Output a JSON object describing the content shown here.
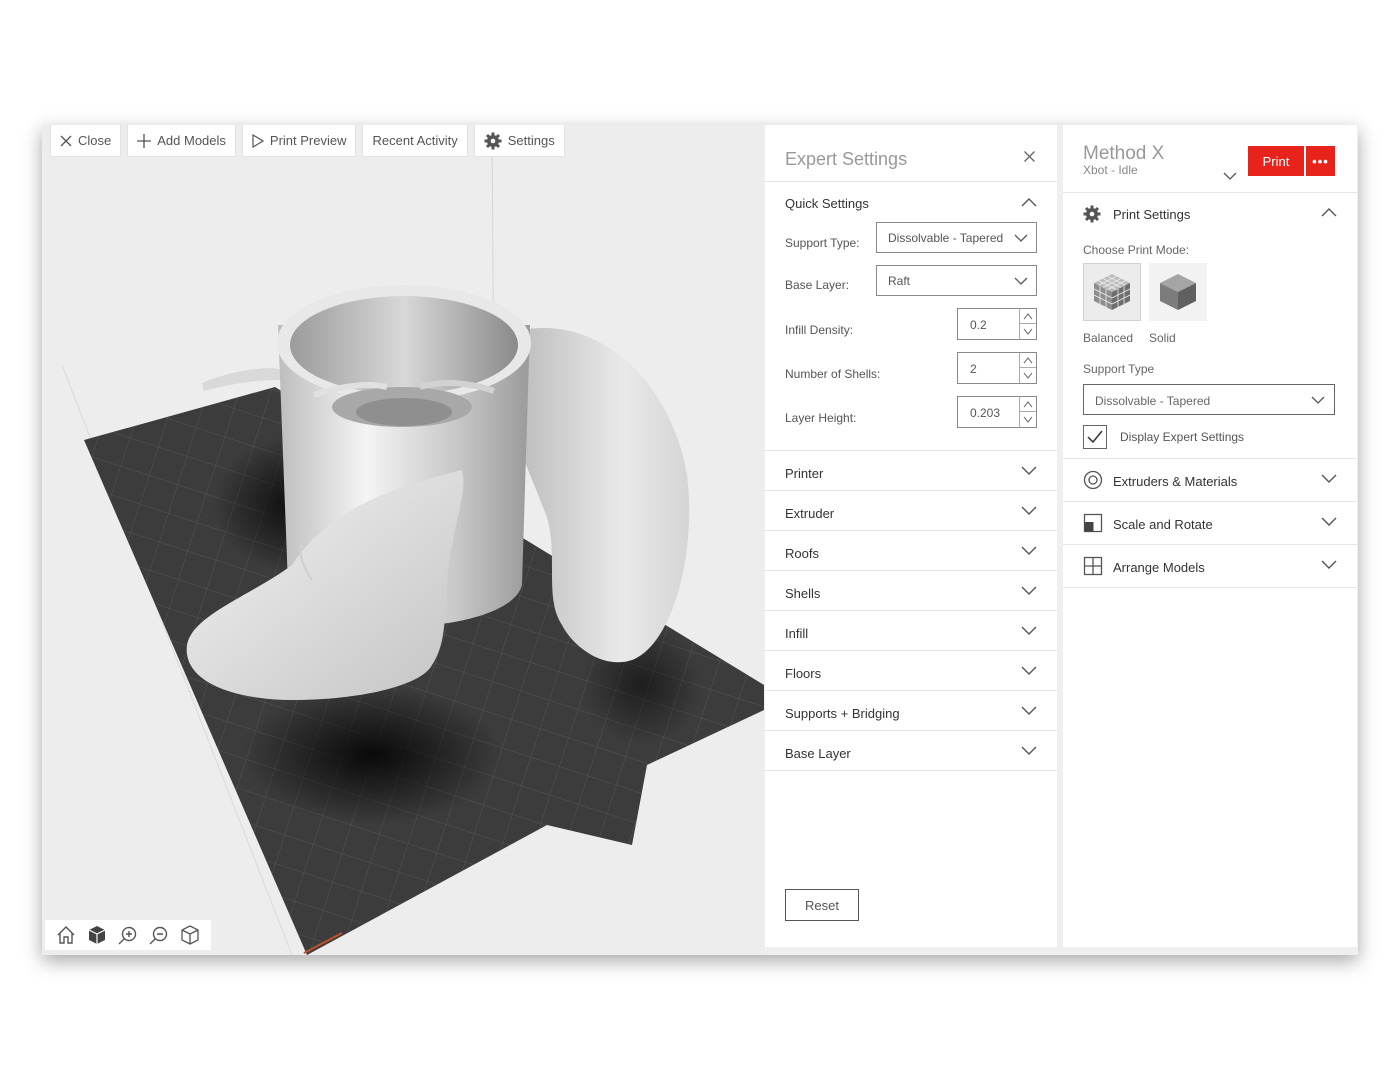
{
  "toolbar": {
    "close": "Close",
    "add_models": "Add Models",
    "print_preview": "Print Preview",
    "recent_activity": "Recent Activity",
    "settings": "Settings"
  },
  "expert": {
    "title": "Expert Settings",
    "quick_settings": "Quick Settings",
    "support_type_label": "Support Type:",
    "support_type_value": "Dissolvable - Tapered",
    "base_layer_label": "Base Layer:",
    "base_layer_value": "Raft",
    "infill_label": "Infill Density:",
    "infill_value": "0.2",
    "shells_label": "Number of Shells:",
    "shells_value": "2",
    "layer_height_label": "Layer Height:",
    "layer_height_value": "0.203",
    "sections": [
      "Printer",
      "Extruder",
      "Roofs",
      "Shells",
      "Infill",
      "Floors",
      "Supports + Bridging",
      "Base Layer"
    ],
    "reset": "Reset"
  },
  "printer": {
    "name": "Method X",
    "status": "Xbot - Idle",
    "print": "Print",
    "more": "•••",
    "print_settings": "Print Settings",
    "choose_mode": "Choose Print Mode:",
    "modes": [
      "Balanced",
      "Solid"
    ],
    "support_type_label": "Support Type",
    "support_type_value": "Dissolvable - Tapered",
    "display_expert": "Display Expert Settings",
    "display_expert_checked": true,
    "sections": [
      "Extruders & Materials",
      "Scale and Rotate",
      "Arrange Models"
    ]
  },
  "colors": {
    "accent": "#e8231b",
    "build_plate": "#3c3c3c",
    "model": "#e6e6e6"
  }
}
